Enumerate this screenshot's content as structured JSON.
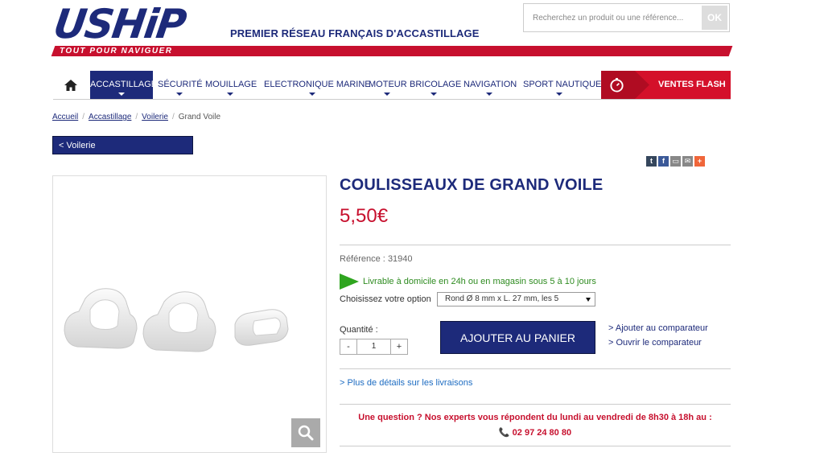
{
  "header": {
    "logo_text": "USHiP",
    "tagline": "PREMIER RÉSEAU FRANÇAIS D'ACCASTILLAGE",
    "slogan": "TOUT POUR NAVIGUER",
    "search_placeholder": "Recherchez un produit ou une référence...",
    "search_button": "OK"
  },
  "nav": {
    "items": [
      {
        "label": "ACCASTILLAGE"
      },
      {
        "label": "SÉCURITÉ"
      },
      {
        "label": "MOUILLAGE"
      },
      {
        "label": "ELECTRONIQUE MARINE"
      },
      {
        "label": "MOTEUR"
      },
      {
        "label": "BRICOLAGE"
      },
      {
        "label": "NAVIGATION"
      },
      {
        "label": "SPORT NAUTIQUE"
      }
    ],
    "flash_label": "VENTES FLASH"
  },
  "breadcrumb": {
    "items": [
      "Accueil",
      "Accastillage",
      "Voilerie",
      "Grand Voile"
    ]
  },
  "back_button": "< Voilerie",
  "share_icons": [
    "tumblr-icon",
    "facebook-icon",
    "print-icon",
    "email-icon",
    "plus-icon"
  ],
  "product": {
    "title": "COULISSEAUX DE GRAND VOILE",
    "price": "5,50€",
    "reference_label": "Référence :",
    "reference_value": "31940",
    "delivery": "Livrable à domicile en 24h ou en magasin sous 5 à 10 jours",
    "option_label": "Choisissez votre option",
    "option_value": "Rond Ø 8 mm x L. 27 mm, les 5",
    "quantity_label": "Quantité :",
    "quantity_value": "1",
    "qty_minus": "-",
    "qty_plus": "+",
    "add_to_cart": "AJOUTER AU PANIER",
    "compare_add": "> Ajouter au comparateur",
    "compare_open": "> Ouvrir le comparateur",
    "more_details": "> Plus de détails sur les livraisons",
    "question": "Une question ? Nos experts vous répondent du lundi au vendredi de 8h30 à 18h au :",
    "phone": "02 97 24 80 80"
  },
  "colors": {
    "brand_blue": "#1d2a7a",
    "brand_red": "#c7102e",
    "delivery_green": "#2fa51f"
  }
}
